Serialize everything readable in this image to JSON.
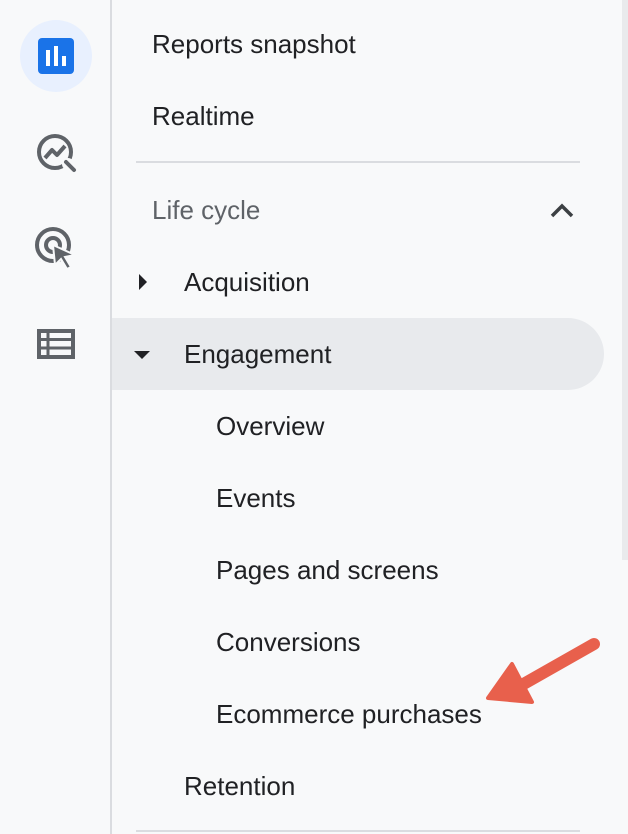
{
  "rail": {
    "items": [
      {
        "icon": "bar-chart-icon",
        "active": true
      },
      {
        "icon": "explore-insights-icon",
        "active": false
      },
      {
        "icon": "advertising-cursor-icon",
        "active": false
      },
      {
        "icon": "list-table-icon",
        "active": false
      }
    ]
  },
  "nav": {
    "reports_snapshot": "Reports snapshot",
    "realtime": "Realtime",
    "section": {
      "title": "Life cycle",
      "acquisition": "Acquisition",
      "engagement": {
        "label": "Engagement",
        "children": [
          "Overview",
          "Events",
          "Pages and screens",
          "Conversions",
          "Ecommerce purchases"
        ]
      },
      "retention": "Retention"
    }
  },
  "colors": {
    "accent": "#1a73e8",
    "active_rail_bg": "#e8f0fe",
    "selected_bg": "#e8eaed",
    "annotation_arrow": "#e8604c"
  }
}
